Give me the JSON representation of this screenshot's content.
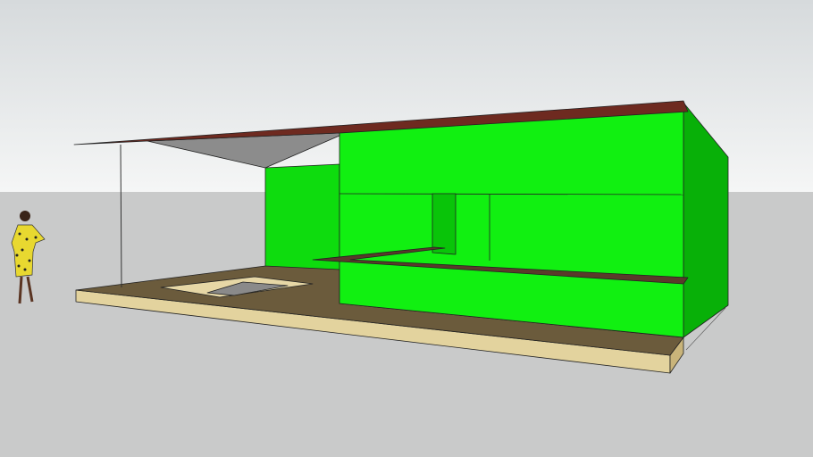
{
  "colors": {
    "sky_top": "#d9dddf",
    "sky_horizon": "#f4f5f5",
    "ground": "#c9caca",
    "roof": "#6e2a20",
    "roof_underside": "#8c8c8c",
    "wall_front": "#11f011",
    "wall_side": "#08b008",
    "wall_back": "#0edc0e",
    "floor_top": "#6b5b3c",
    "floor_edge": "#e3d39e",
    "floor_side": "#c9b47a",
    "pit_rim": "#e6d7a6",
    "pit_inner": "#8a8a8a",
    "counter": "#5a3a2a",
    "person_dress": "#e8d830",
    "person_skin": "#5a3422"
  }
}
